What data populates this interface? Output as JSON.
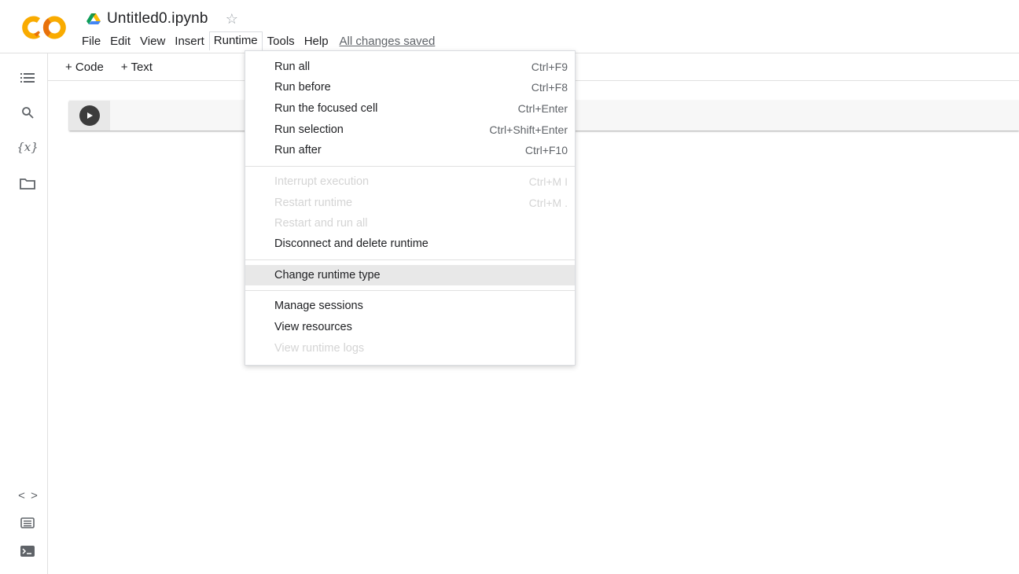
{
  "header": {
    "doc_title": "Untitled0.ipynb",
    "saved_status": "All changes saved"
  },
  "menubar": [
    "File",
    "Edit",
    "View",
    "Insert",
    "Runtime",
    "Tools",
    "Help"
  ],
  "toolbar": {
    "add_code": "+ Code",
    "add_text": "+ Text"
  },
  "rail": {
    "variables_label": "{x}",
    "code_snippets_label": "< >"
  },
  "runtime_menu": {
    "group1": [
      {
        "label": "Run all",
        "shortcut": "Ctrl+F9"
      },
      {
        "label": "Run before",
        "shortcut": "Ctrl+F8"
      },
      {
        "label": "Run the focused cell",
        "shortcut": "Ctrl+Enter"
      },
      {
        "label": "Run selection",
        "shortcut": "Ctrl+Shift+Enter"
      },
      {
        "label": "Run after",
        "shortcut": "Ctrl+F10"
      }
    ],
    "group2": [
      {
        "label": "Interrupt execution",
        "shortcut": "Ctrl+M I"
      },
      {
        "label": "Restart runtime",
        "shortcut": "Ctrl+M ."
      },
      {
        "label": "Restart and run all",
        "shortcut": ""
      },
      {
        "label": "Disconnect and delete runtime",
        "shortcut": ""
      }
    ],
    "group3": [
      {
        "label": "Change runtime type",
        "shortcut": ""
      }
    ],
    "group4": [
      {
        "label": "Manage sessions",
        "shortcut": ""
      },
      {
        "label": "View resources",
        "shortcut": ""
      },
      {
        "label": "View runtime logs",
        "shortcut": ""
      }
    ]
  },
  "colors": {
    "logo_orange": "#F9AB00",
    "logo_amber": "#E8710A",
    "menu_highlight": "#e8e8e8",
    "disabled_text": "#d4d4d4"
  }
}
